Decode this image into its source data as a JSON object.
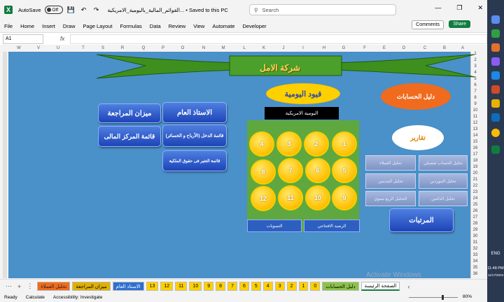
{
  "titlebar": {
    "autosave_label": "AutoSave",
    "autosave_state": "Off",
    "doc_title": "القوائم_المالية_باليومية_الامريكية... • Saved to this PC",
    "search_placeholder": "Search"
  },
  "menu": {
    "items": [
      "File",
      "Home",
      "Insert",
      "Draw",
      "Page Layout",
      "Formulas",
      "Data",
      "Review",
      "View",
      "Automate",
      "Developer"
    ],
    "comments": "Comments",
    "share": "Share"
  },
  "formula": {
    "namebox": "A1",
    "fx": "fx"
  },
  "columns": [
    "W",
    "V",
    "U",
    "T",
    "S",
    "R",
    "Q",
    "P",
    "O",
    "N",
    "M",
    "L",
    "K",
    "J",
    "I",
    "H",
    "G",
    "F",
    "E",
    "D",
    "C",
    "B",
    "A"
  ],
  "rows": [
    "1",
    "2",
    "3",
    "4",
    "5",
    "6",
    "7",
    "8",
    "9",
    "10",
    "11",
    "12",
    "13",
    "14",
    "15",
    "16",
    "17",
    "18",
    "19",
    "20",
    "21",
    "22",
    "23",
    "24",
    "25",
    "26",
    "27",
    "28",
    "29",
    "30",
    "31",
    "32",
    "33",
    "34",
    "35",
    "36"
  ],
  "sheet": {
    "company": "شركة الامل",
    "journal": "قيود اليومية",
    "accounts_guide": "دليل الحسابات",
    "reports": "تقارير",
    "us_journal": "اليومية الامريكية",
    "general_ledger": "الاستاذ العام",
    "trial_balance": "ميزان المراجعة",
    "income_statement": "قائمة الدخل (الأرباح و الخسائر)",
    "balance_sheet": "قائمة المركز المالى",
    "equity_statement": "قائمة التغير فى حقوق الملكية",
    "ranks": "المرتبات",
    "opening_balance": "الرصيد الافتتاحي",
    "vouchers": "التسويات",
    "coins": [
      "1",
      "2",
      "3",
      "4",
      "5",
      "6",
      "7",
      "8",
      "9",
      "10",
      "11",
      "12"
    ],
    "report_buttons": [
      "تحليل الحساب تفصيلي",
      "تحليل العملاء",
      "تحليل الموردين",
      "تحليل المدينين",
      "تحليل الدائنين",
      "التحليل الربع سنوي"
    ],
    "watermark": "Activate Windows"
  },
  "tabs": [
    {
      "label": "تحليل العملاء",
      "style": "orange"
    },
    {
      "label": "ميزان المراجعة",
      "style": "gold"
    },
    {
      "label": "الاستاذ العام",
      "style": "blue"
    },
    {
      "label": "13",
      "style": "yellow"
    },
    {
      "label": "12",
      "style": "yellow"
    },
    {
      "label": "11",
      "style": "yellow"
    },
    {
      "label": "10",
      "style": "yellow"
    },
    {
      "label": "9",
      "style": "yellow"
    },
    {
      "label": "8",
      "style": "yellow"
    },
    {
      "label": "7",
      "style": "yellow"
    },
    {
      "label": "6",
      "style": "yellow"
    },
    {
      "label": "5",
      "style": "yellow"
    },
    {
      "label": "4",
      "style": "yellow"
    },
    {
      "label": "3",
      "style": "yellow"
    },
    {
      "label": "2",
      "style": "yellow"
    },
    {
      "label": "1",
      "style": "yellow"
    },
    {
      "label": "0",
      "style": "yellow"
    },
    {
      "label": "دليل الحسابات",
      "style": "green"
    },
    {
      "label": "الصفحة الرئيسة",
      "style": "active"
    }
  ],
  "status": {
    "ready": "Ready",
    "calculate": "Calculate",
    "accessibility": "Accessibility: Investigate",
    "zoom": "80%"
  },
  "taskbar": {
    "lang": "ENG",
    "time": "11:48 PM",
    "date": "11/17/2024"
  }
}
